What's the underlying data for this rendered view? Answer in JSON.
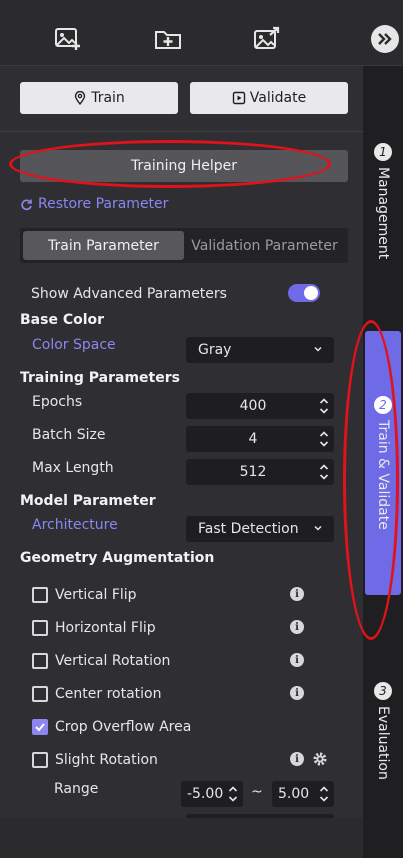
{
  "toolbar": {
    "icons": [
      "add-image-icon",
      "add-folder-icon",
      "export-image-icon"
    ],
    "collapse_icon": "double-chevron-right-icon"
  },
  "actions": {
    "train_label": "Train",
    "validate_label": "Validate"
  },
  "helper_button_label": "Training Helper",
  "restore_label": "Restore Parameter",
  "tabs": {
    "active": "Train Parameter",
    "inactive": "Validation Parameter"
  },
  "advanced": {
    "label": "Show Advanced Parameters",
    "enabled": true
  },
  "base_color": {
    "heading": "Base Color",
    "color_space_label": "Color Space",
    "color_space_value": "Gray"
  },
  "training": {
    "heading": "Training Parameters",
    "epochs_label": "Epochs",
    "epochs_value": "400",
    "batch_label": "Batch Size",
    "batch_value": "4",
    "maxlen_label": "Max Length",
    "maxlen_value": "512"
  },
  "model": {
    "heading": "Model Parameter",
    "arch_label": "Architecture",
    "arch_value": "Fast Detection"
  },
  "geometry": {
    "heading": "Geometry Augmentation",
    "items": [
      {
        "label": "Vertical Flip",
        "checked": false
      },
      {
        "label": "Horizontal Flip",
        "checked": false
      },
      {
        "label": "Vertical Rotation",
        "checked": false
      },
      {
        "label": "Center rotation",
        "checked": false
      },
      {
        "label": "Crop Overflow Area",
        "checked": true
      },
      {
        "label": "Slight Rotation",
        "checked": false
      }
    ],
    "range_label": "Range",
    "range_min": "-5.00",
    "range_sep": "~",
    "range_max": "5.00"
  },
  "side_tabs": [
    {
      "num": "1",
      "label": "Management"
    },
    {
      "num": "2",
      "label": "Train & Validate"
    },
    {
      "num": "3",
      "label": "Evaluation"
    }
  ],
  "colors": {
    "accent": "#6f6ae6",
    "link": "#8b86f0",
    "annotation": "#e2121a"
  }
}
